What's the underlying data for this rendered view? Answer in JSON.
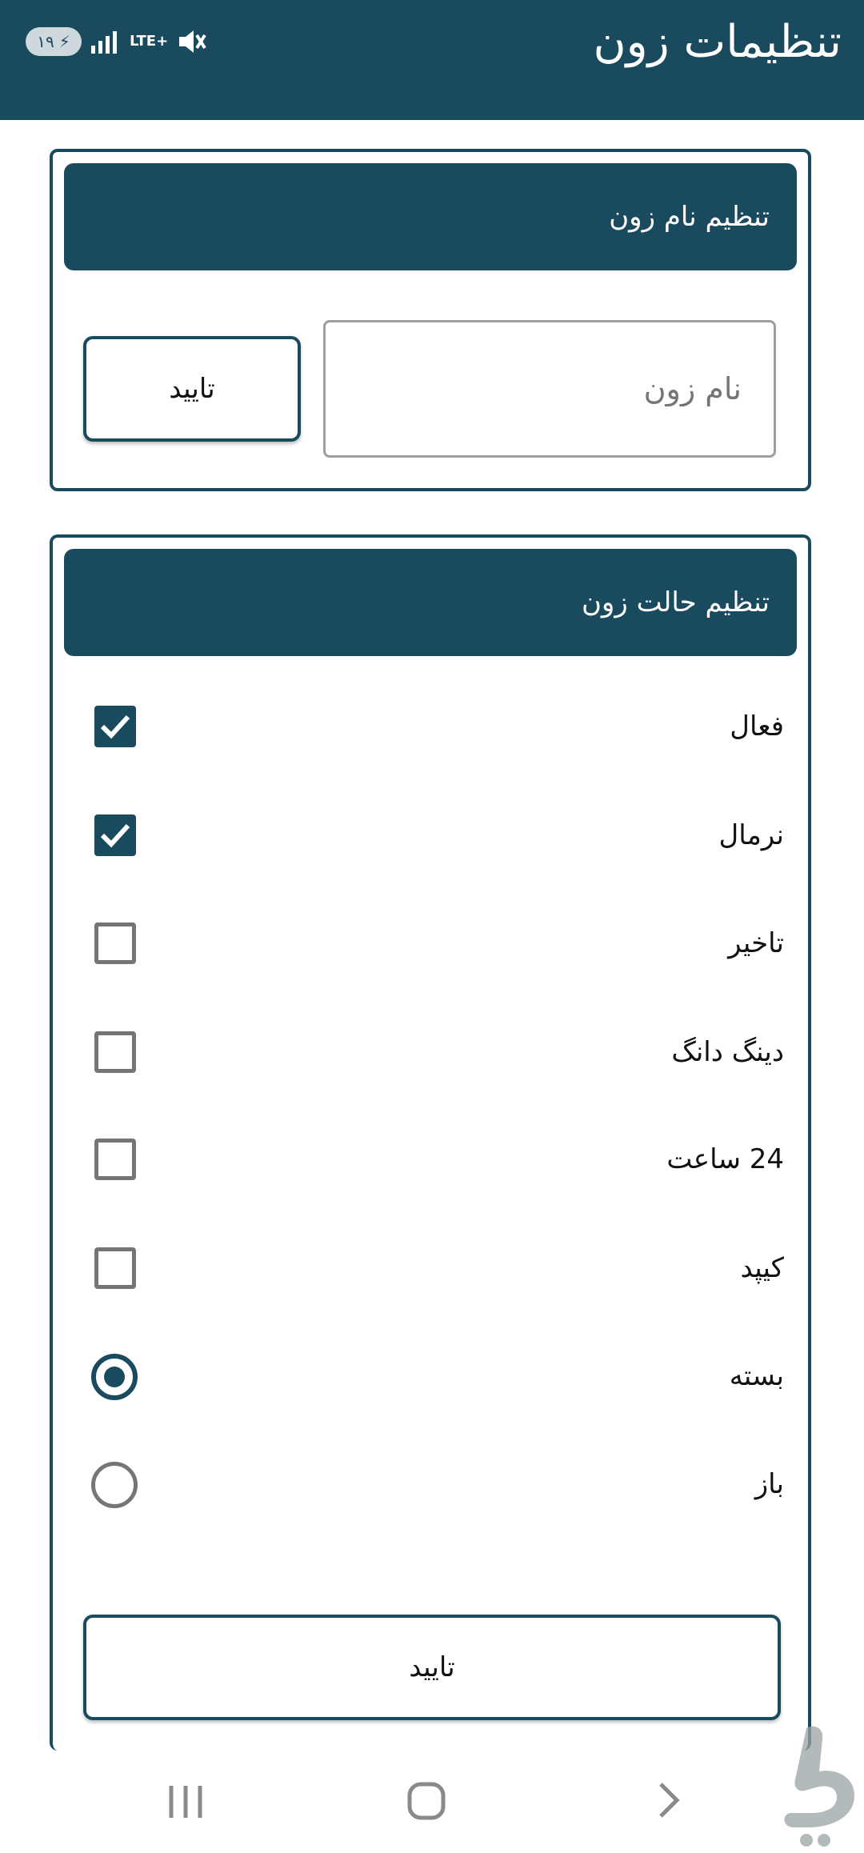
{
  "status_bar": {
    "battery_level": "۱۹",
    "network": "LTE+",
    "colors": {
      "bar": "#1a4a5e"
    }
  },
  "app_bar": {
    "title": "تنظیمات زون"
  },
  "name_card": {
    "header": "تنظیم نام زون",
    "name_input_placeholder": "نام زون",
    "name_input_value": "",
    "confirm_button": "تایید"
  },
  "mode_card": {
    "header": "تنظیم حالت زون",
    "checkboxes": [
      {
        "label": "فعال",
        "checked": true
      },
      {
        "label": "نرمال",
        "checked": true
      },
      {
        "label": "تاخیر",
        "checked": false
      },
      {
        "label": "دینگ دانگ",
        "checked": false
      },
      {
        "label": "24 ساعت",
        "checked": false
      },
      {
        "label": "کیپد",
        "checked": false
      }
    ],
    "radios": [
      {
        "label": "بسته",
        "selected": true
      },
      {
        "label": "باز",
        "selected": false
      }
    ],
    "confirm_button": "تایید"
  },
  "nav_bar": {
    "icons": [
      "recent-apps-icon",
      "home-icon",
      "back-icon"
    ]
  },
  "theme": {
    "primary": "#1a4a5e",
    "unchecked": "#757575"
  }
}
